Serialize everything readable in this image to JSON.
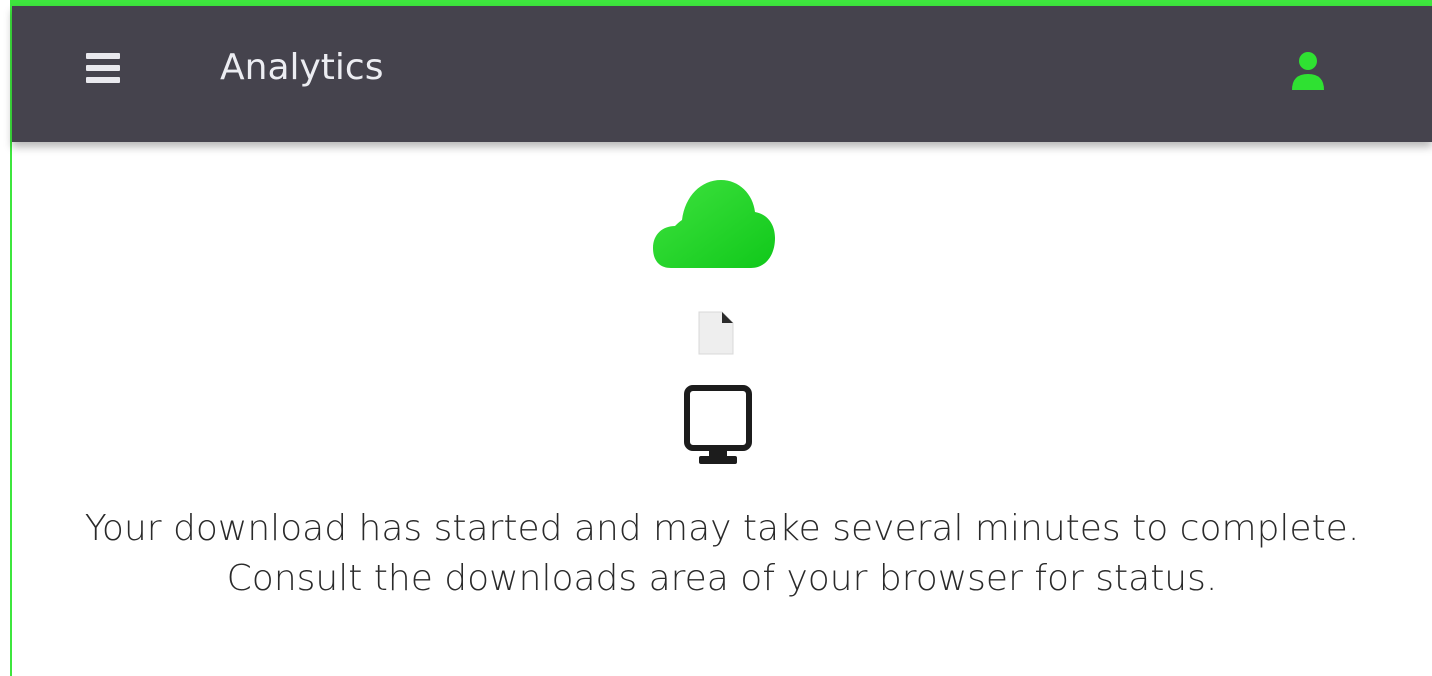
{
  "app": {
    "title": "Analytics"
  },
  "header": {
    "menu_icon": "hamburger-menu-icon",
    "user_icon": "user-icon"
  },
  "status": {
    "illustration": {
      "cloud_icon": "cloud-icon",
      "file_icon": "file-icon",
      "computer_icon": "monitor-icon"
    },
    "message_line1": "Your download has started and may take several minutes to complete.",
    "message_line2": "Consult the downloads area of your browser for status."
  },
  "colors": {
    "appbar": "#45434d",
    "accent_green": "#22cc2a",
    "frame_border": "#3ee63e"
  }
}
